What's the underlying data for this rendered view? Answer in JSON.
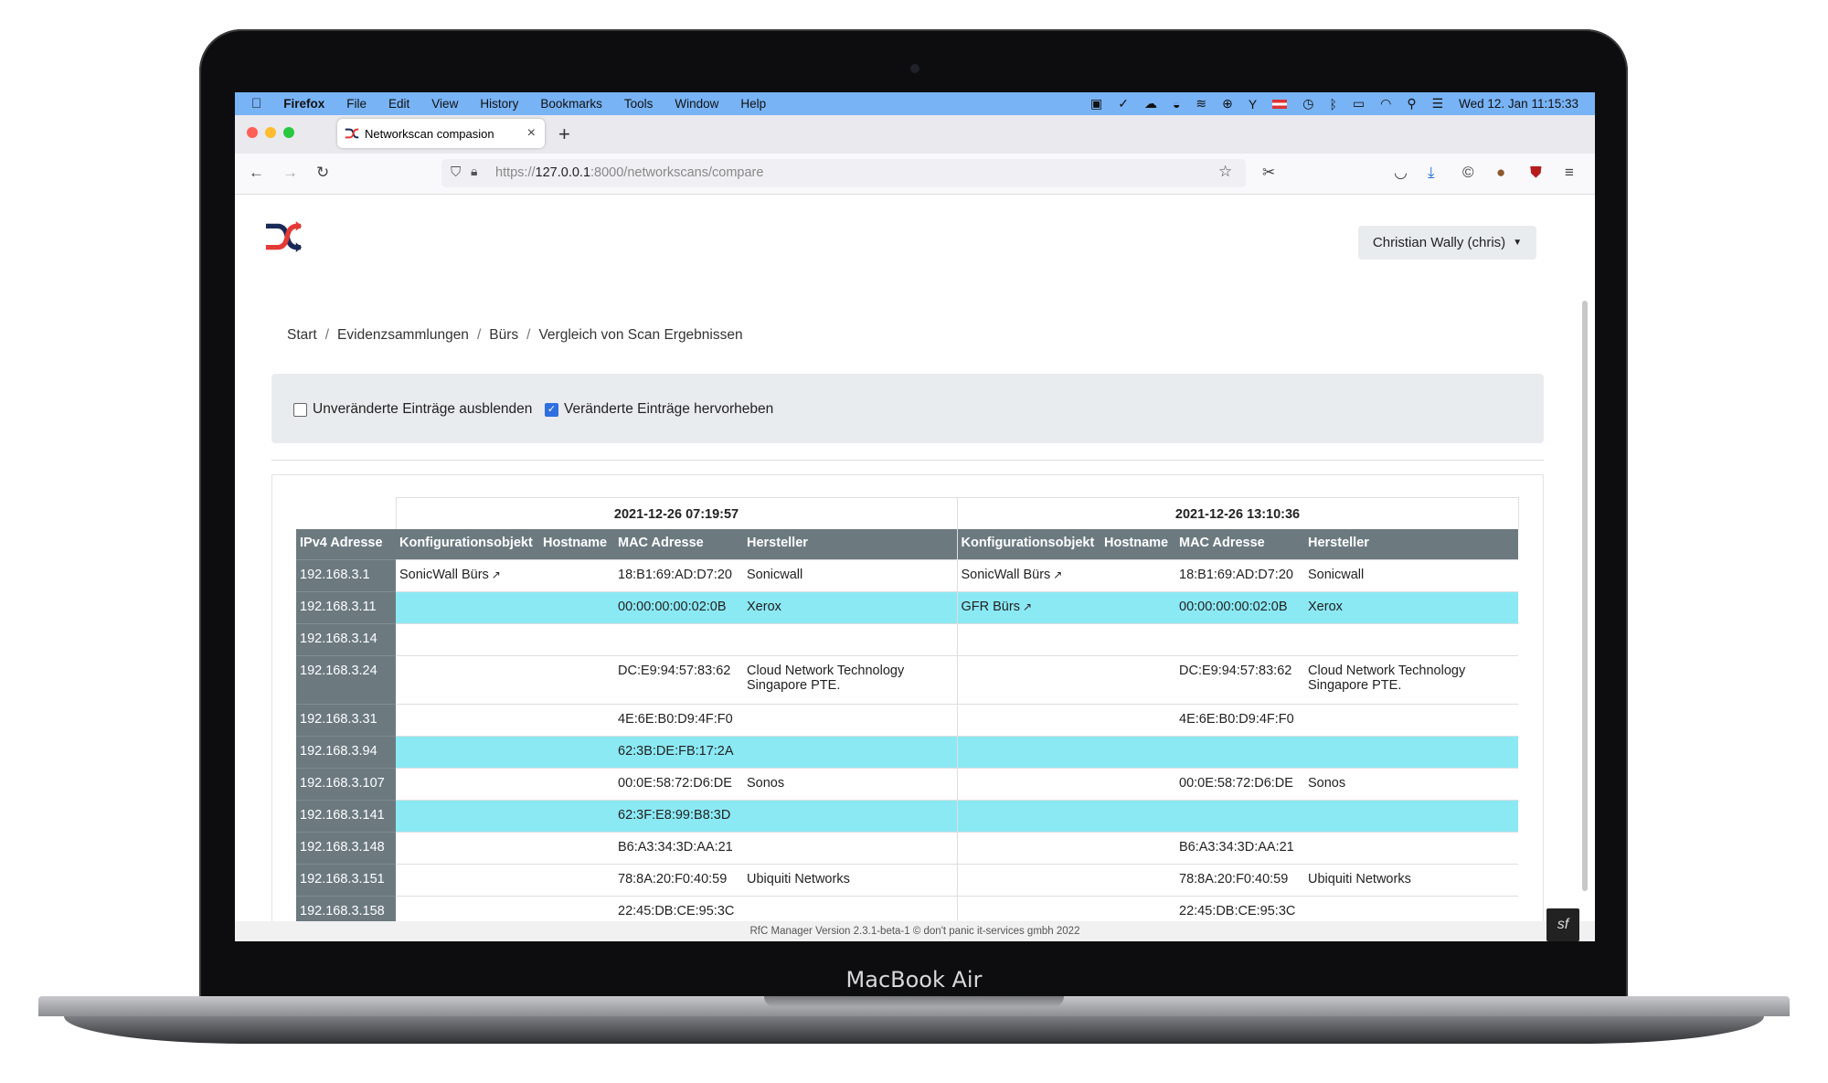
{
  "menubar": {
    "apple": "",
    "app": "Firefox",
    "items": [
      "File",
      "Edit",
      "View",
      "History",
      "Bookmarks",
      "Tools",
      "Window",
      "Help"
    ],
    "clock": "Wed 12. Jan  11:15:33"
  },
  "tab": {
    "title": "Networkscan compasion",
    "close": "×",
    "new": "+"
  },
  "url": {
    "prefix": "https://",
    "host": "127.0.0.1",
    "path": ":8000/networkscans/compare"
  },
  "user": {
    "label": "Christian Wally (chris)"
  },
  "breadcrumb": [
    "Start",
    "Evidenzsammlungen",
    "Bürs",
    "Vergleich von Scan Ergebnissen"
  ],
  "filters": {
    "hide_unchanged": "Unveränderte Einträge ausblenden",
    "highlight_changed": "Veränderte Einträge hervorheben"
  },
  "table": {
    "scan_left": "2021-12-26 07:19:57",
    "scan_right": "2021-12-26 13:10:36",
    "headers": [
      "IPv4 Adresse",
      "Konfigurationsobjekt",
      "Hostname",
      "MAC Adresse",
      "Hersteller",
      "Konfigurationsobjekt",
      "Hostname",
      "MAC Adresse",
      "Hersteller"
    ],
    "rows": [
      {
        "ip": "192.168.3.1",
        "changed": false,
        "l_obj": "SonicWall Bürs",
        "l_host": "",
        "l_mac": "18:B1:69:AD:D7:20",
        "l_vendor": "Sonicwall",
        "r_obj": "SonicWall Bürs",
        "r_host": "",
        "r_mac": "18:B1:69:AD:D7:20",
        "r_vendor": "Sonicwall"
      },
      {
        "ip": "192.168.3.11",
        "changed": true,
        "l_obj": "",
        "l_host": "",
        "l_mac": "00:00:00:00:02:0B",
        "l_vendor": "Xerox",
        "r_obj": "GFR Bürs",
        "r_host": "",
        "r_mac": "00:00:00:00:02:0B",
        "r_vendor": "Xerox"
      },
      {
        "ip": "192.168.3.14",
        "changed": false,
        "l_obj": "",
        "l_host": "",
        "l_mac": "",
        "l_vendor": "",
        "r_obj": "",
        "r_host": "",
        "r_mac": "",
        "r_vendor": ""
      },
      {
        "ip": "192.168.3.24",
        "changed": false,
        "l_obj": "",
        "l_host": "",
        "l_mac": "DC:E9:94:57:83:62",
        "l_vendor": "Cloud Network Technology Singapore PTE.",
        "r_obj": "",
        "r_host": "",
        "r_mac": "DC:E9:94:57:83:62",
        "r_vendor": "Cloud Network Technology Singapore PTE."
      },
      {
        "ip": "192.168.3.31",
        "changed": false,
        "l_obj": "",
        "l_host": "",
        "l_mac": "4E:6E:B0:D9:4F:F0",
        "l_vendor": "",
        "r_obj": "",
        "r_host": "",
        "r_mac": "4E:6E:B0:D9:4F:F0",
        "r_vendor": ""
      },
      {
        "ip": "192.168.3.94",
        "changed": true,
        "l_obj": "",
        "l_host": "",
        "l_mac": "62:3B:DE:FB:17:2A",
        "l_vendor": "",
        "r_obj": "",
        "r_host": "",
        "r_mac": "",
        "r_vendor": ""
      },
      {
        "ip": "192.168.3.107",
        "changed": false,
        "l_obj": "",
        "l_host": "",
        "l_mac": "00:0E:58:72:D6:DE",
        "l_vendor": "Sonos",
        "r_obj": "",
        "r_host": "",
        "r_mac": "00:0E:58:72:D6:DE",
        "r_vendor": "Sonos"
      },
      {
        "ip": "192.168.3.141",
        "changed": true,
        "l_obj": "",
        "l_host": "",
        "l_mac": "62:3F:E8:99:B8:3D",
        "l_vendor": "",
        "r_obj": "",
        "r_host": "",
        "r_mac": "",
        "r_vendor": ""
      },
      {
        "ip": "192.168.3.148",
        "changed": false,
        "l_obj": "",
        "l_host": "",
        "l_mac": "B6:A3:34:3D:AA:21",
        "l_vendor": "",
        "r_obj": "",
        "r_host": "",
        "r_mac": "B6:A3:34:3D:AA:21",
        "r_vendor": ""
      },
      {
        "ip": "192.168.3.151",
        "changed": false,
        "l_obj": "",
        "l_host": "",
        "l_mac": "78:8A:20:F0:40:59",
        "l_vendor": "Ubiquiti Networks",
        "r_obj": "",
        "r_host": "",
        "r_mac": "78:8A:20:F0:40:59",
        "r_vendor": "Ubiquiti Networks"
      },
      {
        "ip": "192.168.3.158",
        "changed": false,
        "l_obj": "",
        "l_host": "",
        "l_mac": "22:45:DB:CE:95:3C",
        "l_vendor": "",
        "r_obj": "",
        "r_host": "",
        "r_mac": "22:45:DB:CE:95:3C",
        "r_vendor": ""
      }
    ]
  },
  "footer": "RfC Manager Version 2.3.1-beta-1    © don't panic it-services gmbh 2022",
  "device_label": "MacBook Air",
  "colors": {
    "menubar": "#78b3f5",
    "header": "#6c7a80",
    "changed": "#8be9f4",
    "logo_red": "#e53935",
    "logo_navy": "#1a2a57"
  }
}
